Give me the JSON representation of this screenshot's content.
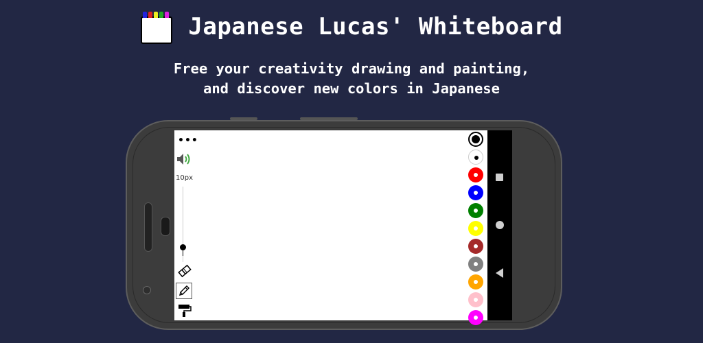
{
  "banner": {
    "title": "Japanese Lucas' Whiteboard",
    "subtitle_line1": "Free your creativity drawing and painting,",
    "subtitle_line2": "and discover new colors in Japanese",
    "logo_marker_colors": [
      "#2222dd",
      "#dd2222",
      "#eeee22",
      "#22aa22",
      "#dd22dd"
    ]
  },
  "toolbar": {
    "menu_label": "•••",
    "brush_size_label": "10px",
    "brush_size_level": 0.2
  },
  "palette": [
    {
      "name": "black",
      "hex": "#000000",
      "selected": true
    },
    {
      "name": "white",
      "hex": "#ffffff"
    },
    {
      "name": "red",
      "hex": "#ff0000"
    },
    {
      "name": "blue",
      "hex": "#0000ff"
    },
    {
      "name": "green",
      "hex": "#008000"
    },
    {
      "name": "yellow",
      "hex": "#ffff00"
    },
    {
      "name": "brown",
      "hex": "#a52a2a"
    },
    {
      "name": "gray",
      "hex": "#808080"
    },
    {
      "name": "orange",
      "hex": "#ffa500"
    },
    {
      "name": "pink",
      "hex": "#ffc0cb"
    },
    {
      "name": "magenta",
      "hex": "#ff00ff"
    }
  ],
  "icons": {
    "sound": "speaker-on-icon",
    "eraser": "eraser-icon",
    "pencil": "pencil-icon",
    "roller": "paint-roller-icon",
    "nav_recents": "square-icon",
    "nav_home": "circle-icon",
    "nav_back": "triangle-back-icon"
  },
  "colors": {
    "background": "#222744",
    "phone_body": "#3c3c3c",
    "sound_wave": "#44aa44"
  }
}
